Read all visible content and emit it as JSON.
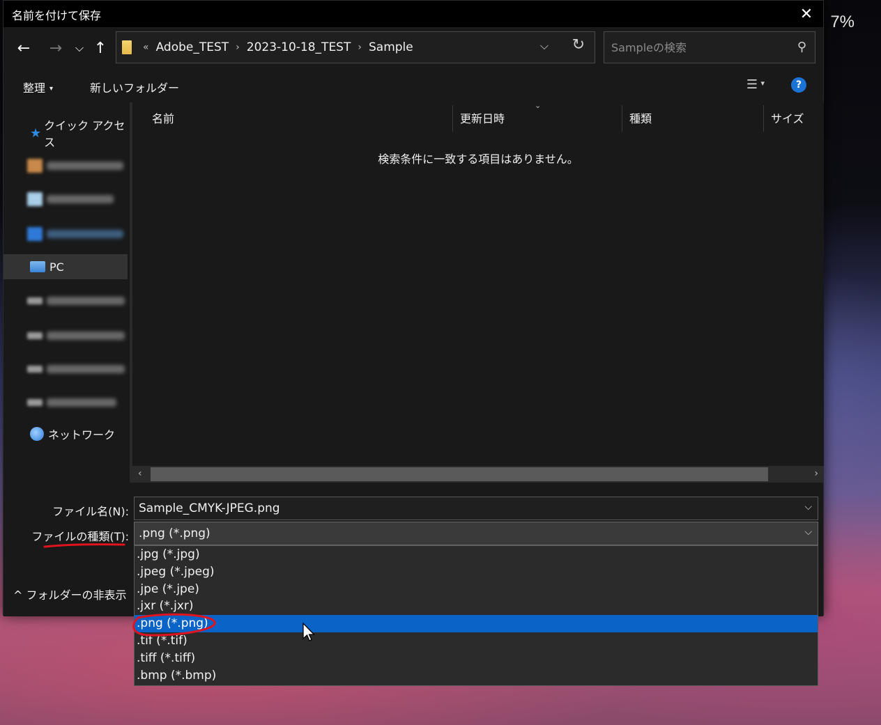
{
  "background": {
    "percent_text": "7%"
  },
  "dialog": {
    "title": "名前を付けて保存",
    "close_glyph": "✕"
  },
  "nav": {
    "back_glyph": "←",
    "forward_glyph": "→",
    "recent_glyph": "⌵",
    "up_glyph": "↑",
    "breadcrumb_overflow": "«",
    "breadcrumbs": [
      "Adobe_TEST",
      "2023-10-18_TEST",
      "Sample"
    ],
    "separator": "›",
    "dropdown_glyph": "⌵",
    "refresh_glyph": "↻",
    "search_placeholder": "Sampleの検索",
    "search_glyph": "⚲"
  },
  "toolbar": {
    "organize_label": "整理",
    "organize_caret": "▾",
    "new_folder_label": "新しいフォルダー",
    "view_glyph": "☰",
    "view_caret": "▾",
    "help_glyph": "?"
  },
  "sidebar": {
    "quick_access": "クイック アクセス",
    "pc": "PC",
    "network": "ネットワーク"
  },
  "columns": {
    "name": "名前",
    "modified": "更新日時",
    "type": "種類",
    "size": "サイズ",
    "sort_caret": "⌄"
  },
  "content": {
    "empty_message": "検索条件に一致する項目はありません。",
    "scroll_left": "‹",
    "scroll_right": "›"
  },
  "form": {
    "filename_label": "ファイル名(N):",
    "filename_value": "Sample_CMYK-JPEG.png",
    "filetype_label": "ファイルの種類(T):",
    "filetype_value": ".png (*.png)",
    "dropdown_glyph": "⌵",
    "hide_folders_label": "^ フォルダーの非表示"
  },
  "filetype_options": [
    ".jpg (*.jpg)",
    ".jpeg (*.jpeg)",
    ".jpe (*.jpe)",
    ".jxr (*.jxr)",
    ".png (*.png)",
    ".tif (*.tif)",
    ".tiff (*.tiff)",
    ".bmp (*.bmp)"
  ],
  "filetype_selected_index": 4,
  "colors": {
    "accent": "#0a64c8",
    "annotation": "#e0141e",
    "dialog_bg": "#191919"
  }
}
